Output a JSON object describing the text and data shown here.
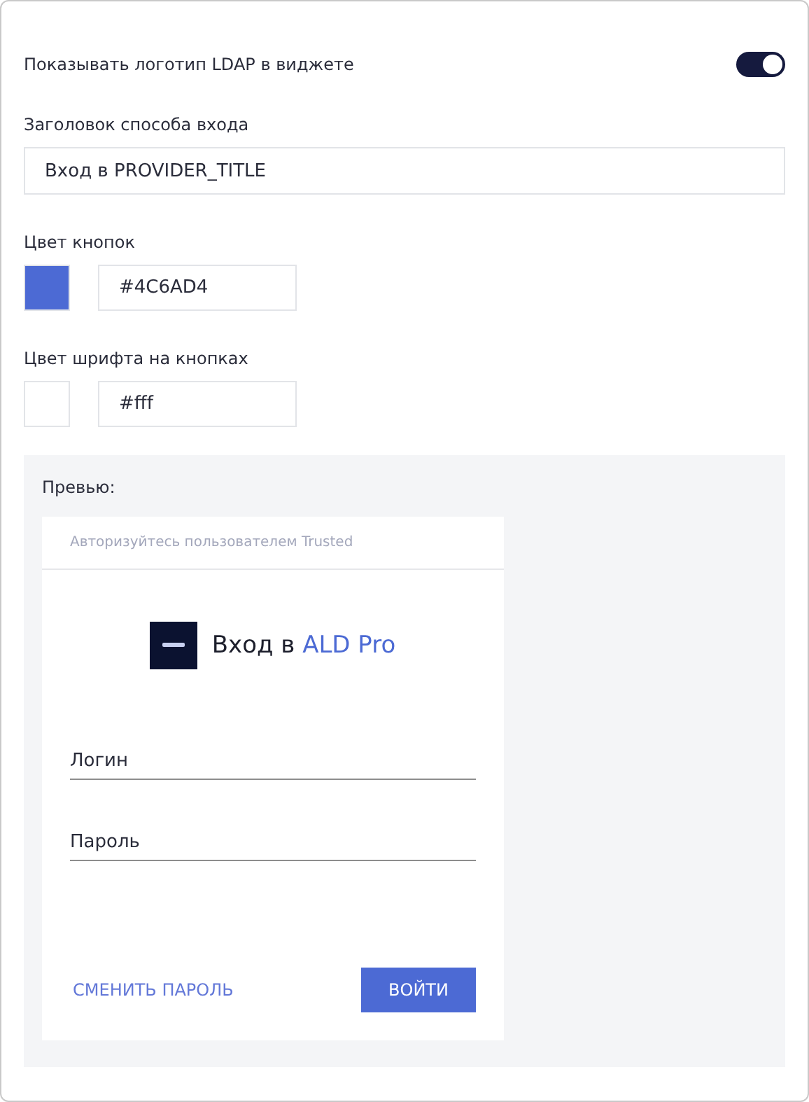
{
  "show_logo": {
    "label": "Показывать логотип LDAP в виджете",
    "on": true
  },
  "title_field": {
    "label": "Заголовок способа входа",
    "value": "Вход в PROVIDER_TITLE"
  },
  "button_color": {
    "label": "Цвет кнопок",
    "value": "#4C6AD4",
    "color": "#4c6ad4"
  },
  "button_font_color": {
    "label": "Цвет шрифта на кнопках",
    "value": "#fff",
    "color": "#ffffff"
  },
  "preview": {
    "label": "Превью:",
    "widget": {
      "header": "Авторизуйтесь пользователем Trusted",
      "title_prefix": "Вход в",
      "title_name": "ALD Pro",
      "fields": [
        {
          "placeholder": "Логин"
        },
        {
          "placeholder": "Пароль"
        }
      ],
      "change_password": "СМЕНИТЬ ПАРОЛЬ",
      "submit": "ВОЙТИ"
    }
  }
}
